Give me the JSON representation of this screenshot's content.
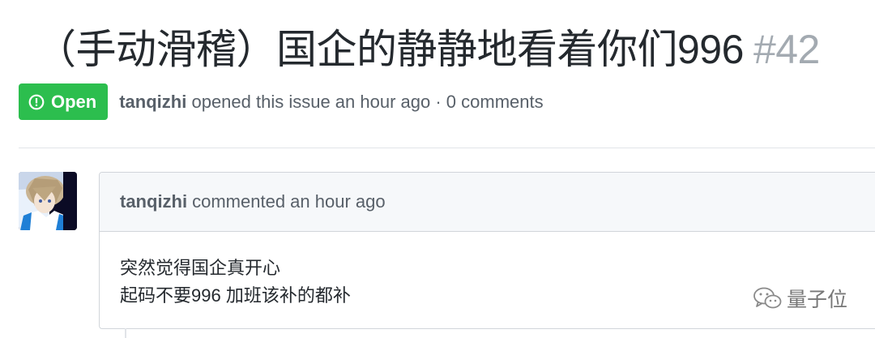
{
  "issue": {
    "title": "（手动滑稽）国企的静静地看着你们996",
    "number": "#42",
    "state": "Open",
    "author": "tanqizhi",
    "meta_text": "opened this issue an hour ago · 0 comments"
  },
  "comment": {
    "author": "tanqizhi",
    "action": "commented an hour ago",
    "body_lines": [
      "突然觉得国企真开心",
      "起码不要996 加班该补的都补"
    ]
  },
  "watermark": {
    "text": "量子位"
  },
  "colors": {
    "open_badge": "#2cbe4e",
    "text": "#24292e",
    "muted": "#586069",
    "issue_number": "#a3aab1",
    "border": "#d1d5da",
    "header_bg": "#f6f8fa"
  },
  "icons": {
    "state": "issue-opened-icon",
    "watermark": "wechat-icon"
  }
}
